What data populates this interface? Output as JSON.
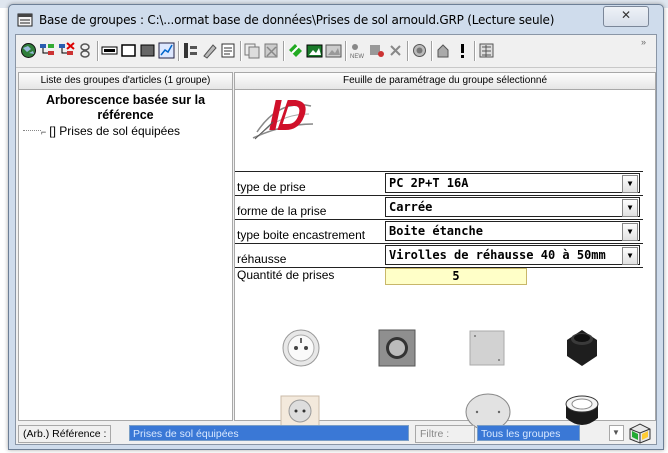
{
  "window": {
    "title": "Base de groupes : C:\\...ormat base de données\\Prises de sol arnould.GRP (Lecture seule)",
    "close_symbol": "✕"
  },
  "toolbar": {
    "icons": [
      "globe-icon",
      "tree-icon",
      "tree-delete-icon",
      "unlink-icon",
      "minus-box-icon",
      "white-rect-icon",
      "gray-rect-icon",
      "chart-icon",
      "columns-icon",
      "pencil-icon",
      "edit-list-icon",
      "copy-icon",
      "delete-list-icon",
      "add-green-icon",
      "add-image-icon",
      "image-icon",
      "new-icon",
      "new-red-icon",
      "cross-icon",
      "photo-icon",
      "export-icon",
      "exclamation-icon",
      "calc-icon"
    ],
    "more": "»"
  },
  "left_panel": {
    "header": "Liste des groupes d'articles (1 groupe)",
    "tree_title": "Arborescence basée sur la référence",
    "tree_items": [
      {
        "prefix": "[]",
        "label": "Prises de sol équipées"
      }
    ]
  },
  "right_panel": {
    "header": "Feuille de paramétrage du groupe sélectionné",
    "params": [
      {
        "label": "type de prise",
        "value": "PC 2P+T 16A"
      },
      {
        "label": "forme de la prise",
        "value": "Carrée"
      },
      {
        "label": "type boite encastrement",
        "value": "Boite étanche"
      },
      {
        "label": "réhausse",
        "value": "Virolles de réhausse 40 à 50mm"
      }
    ],
    "quantity": {
      "label": "Quantité de prises",
      "value": "5"
    },
    "dropdown_symbol": "▼"
  },
  "statusbar": {
    "ref_label": "(Arb.) Référence :",
    "ref_value": "Prises de sol équipées",
    "filter_label": "Filtre :",
    "filter_value": "Tous les groupes"
  },
  "colors": {
    "selection": "#3a78d6",
    "quantity_bg": "#ffffc8",
    "logo_red": "#d0102a"
  }
}
